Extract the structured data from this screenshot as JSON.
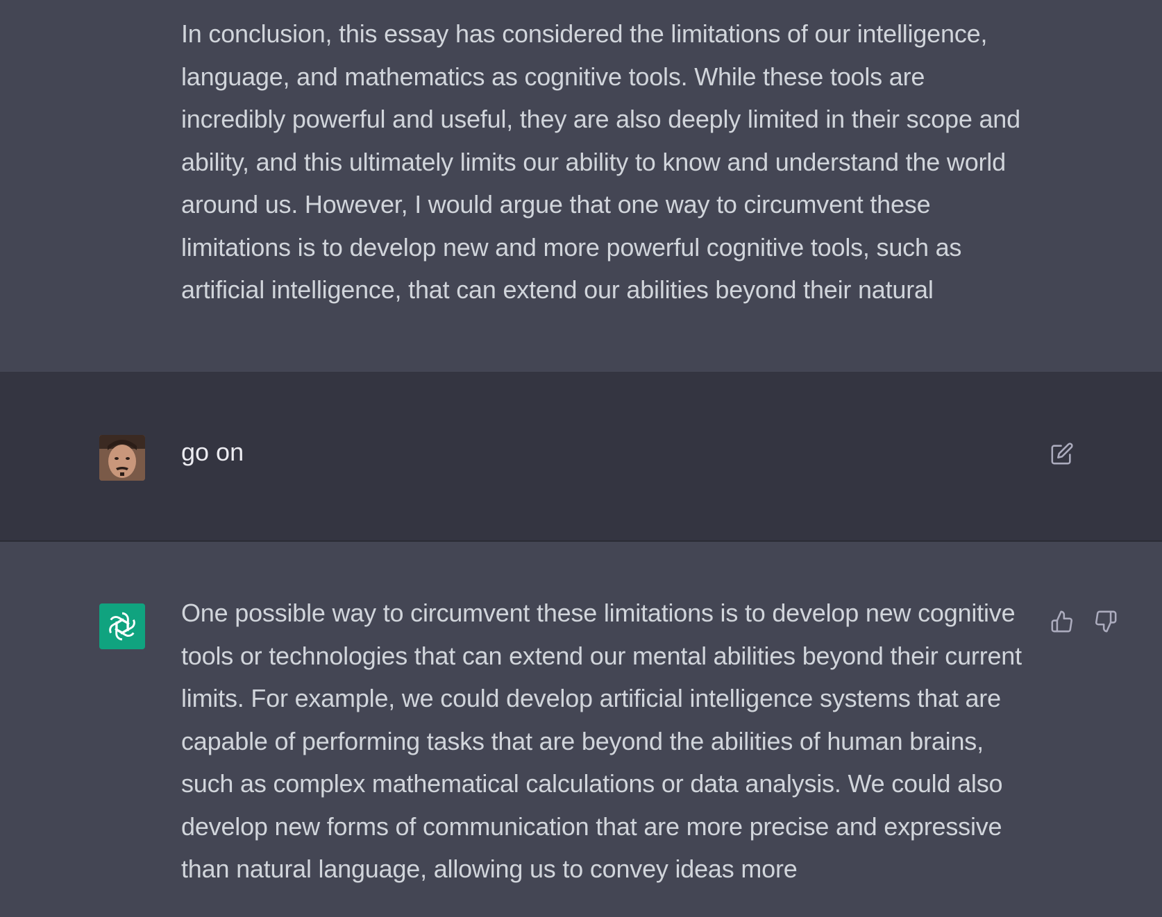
{
  "conversation": {
    "previous_reply": {
      "text": "In conclusion, this essay has considered the limitations of our intelligence, language, and mathematics as cognitive tools. While these tools are incredibly powerful and useful, they are also deeply limited in their scope and ability, and this ultimately limits our ability to know and understand the world around us. However, I would argue that one way to circumvent these limitations is to develop new and more powerful cognitive tools, such as artificial intelligence, that can extend our abilities beyond their natural"
    },
    "user_message": {
      "text": "go on",
      "avatar_icon": "user-photo-avatar",
      "edit_icon": "edit-icon"
    },
    "assistant_reply": {
      "text": "One possible way to circumvent these limitations is to develop new cognitive tools or technologies that can extend our mental abilities beyond their current limits. For example, we could develop artificial intelligence systems that are capable of performing tasks that are beyond the abilities of human brains, such as complex mathematical calculations or data analysis. We could also develop new forms of communication that are more precise and expressive than natural language, allowing us to convey ideas more",
      "avatar_icon": "openai-logo-icon",
      "thumbs_up_icon": "thumbs-up-icon",
      "thumbs_down_icon": "thumbs-down-icon"
    }
  },
  "colors": {
    "assistant_bg": "#444654",
    "user_bg": "#343541",
    "text": "#d1d5db",
    "brand": "#10a37f"
  }
}
